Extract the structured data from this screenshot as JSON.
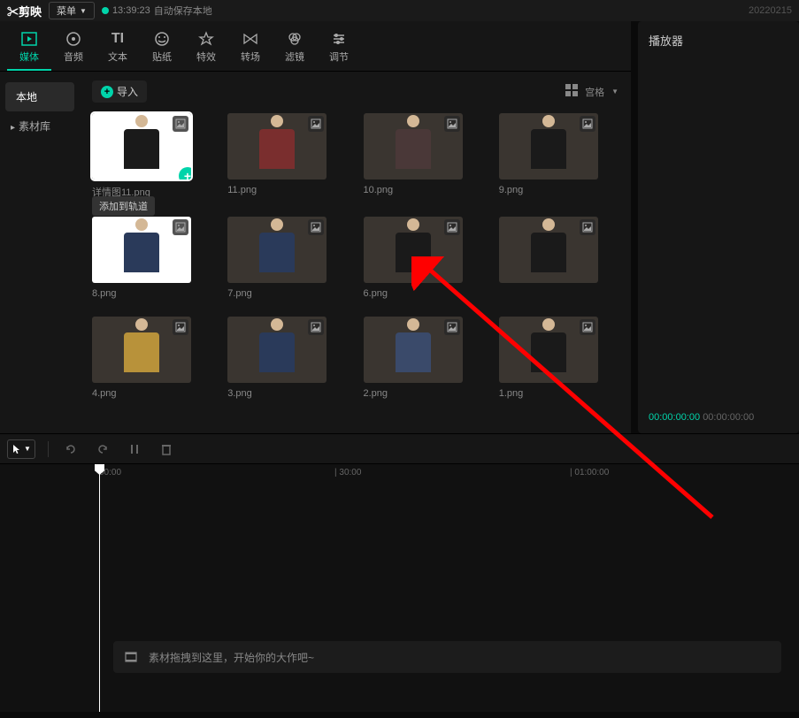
{
  "topbar": {
    "logo": "✂剪映",
    "menu": "菜单",
    "autosave_time": "13:39:23",
    "autosave_text": "自动保存本地",
    "date": "20220215"
  },
  "tabs": [
    {
      "label": "媒体",
      "icon": "media"
    },
    {
      "label": "音频",
      "icon": "audio"
    },
    {
      "label": "文本",
      "icon": "text"
    },
    {
      "label": "贴纸",
      "icon": "sticker"
    },
    {
      "label": "特效",
      "icon": "effect"
    },
    {
      "label": "转场",
      "icon": "transition"
    },
    {
      "label": "滤镜",
      "icon": "filter"
    },
    {
      "label": "调节",
      "icon": "adjust"
    }
  ],
  "sidebar": {
    "items": [
      {
        "label": "本地",
        "active": true
      },
      {
        "label": "素材库",
        "active": false
      }
    ]
  },
  "media": {
    "import": "导入",
    "view_label": "宫格",
    "tooltip": "添加到轨道",
    "items": [
      {
        "name": "详情图11.png",
        "color": "#1a1a1a",
        "selected": true
      },
      {
        "name": "11.png",
        "color": "#7a2e2e"
      },
      {
        "name": "10.png",
        "color": "#4a3838"
      },
      {
        "name": "9.png",
        "color": "#1a1a1a"
      },
      {
        "name": "8.png",
        "color": "#2a3a5a"
      },
      {
        "name": "7.png",
        "color": "#2a3a5a"
      },
      {
        "name": "6.png",
        "color": "#1a1a1a"
      },
      {
        "name": "",
        "color": "#1a1a1a"
      },
      {
        "name": "4.png",
        "color": "#b8923a"
      },
      {
        "name": "3.png",
        "color": "#2a3a5a"
      },
      {
        "name": "2.png",
        "color": "#3a4a6a"
      },
      {
        "name": "1.png",
        "color": "#1a1a1a"
      }
    ]
  },
  "player": {
    "title": "播放器",
    "time_current": "00:00:00:00",
    "time_total": "00:00:00:00"
  },
  "timeline": {
    "ticks": [
      {
        "label": "00:00",
        "pos": 112
      },
      {
        "label": "| 30:00",
        "pos": 378
      },
      {
        "label": "| 01:00:00",
        "pos": 644
      }
    ],
    "drop_hint": "素材拖拽到这里，开始你的大作吧~"
  }
}
